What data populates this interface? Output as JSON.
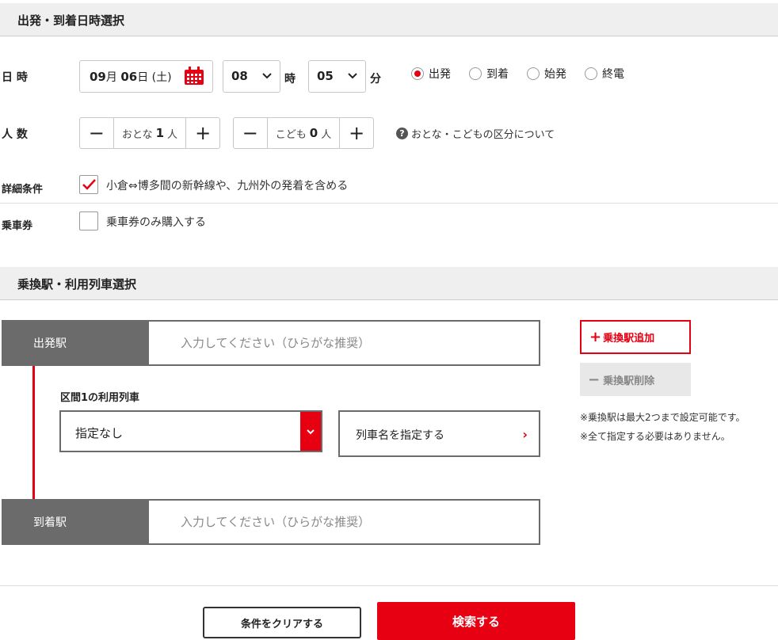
{
  "section1": {
    "title": "出発・到着日時選択"
  },
  "datetime": {
    "label": "日 時",
    "month": "09",
    "month_unit": "月",
    "day": "06",
    "day_unit": "日",
    "weekday": "(土)",
    "hour": "08",
    "hour_unit": "時",
    "minute": "05",
    "minute_unit": "分",
    "modes": [
      "出発",
      "到着",
      "始発",
      "終電"
    ],
    "selected_mode": "出発"
  },
  "passengers": {
    "label": "人 数",
    "adult_label": "おとな",
    "adult_count": "1",
    "child_label": "こども",
    "child_count": "0",
    "unit": "人",
    "minus": "−",
    "plus": "+",
    "help_text": "おとな・こどもの区分について"
  },
  "details": {
    "label": "詳細条件",
    "option": "小倉⇔博多間の新幹線や、九州外の発着を含める",
    "checked": true
  },
  "ticket": {
    "label": "乗車券",
    "option": "乗車券のみ購入する",
    "checked": false
  },
  "section2": {
    "title": "乗換駅・利用列車選択"
  },
  "route": {
    "departure_label": "出発駅",
    "arrival_label": "到着駅",
    "placeholder": "入力してください（ひらがな推奨）",
    "segment_label": "区間1の利用列車",
    "train_select_value": "指定なし",
    "train_name_button": "列車名を指定する"
  },
  "transfer": {
    "add_label": "乗換駅追加",
    "remove_label": "乗換駅削除",
    "note1": "※乗換駅は最大2つまで設定可能です。",
    "note2": "※全て指定する必要はありません。"
  },
  "actions": {
    "clear_label": "条件をクリアする",
    "search_label": "検索する"
  },
  "colors": {
    "accent": "#e60012",
    "tag_bg": "#6b6b6b",
    "section_bg": "#efefef"
  }
}
